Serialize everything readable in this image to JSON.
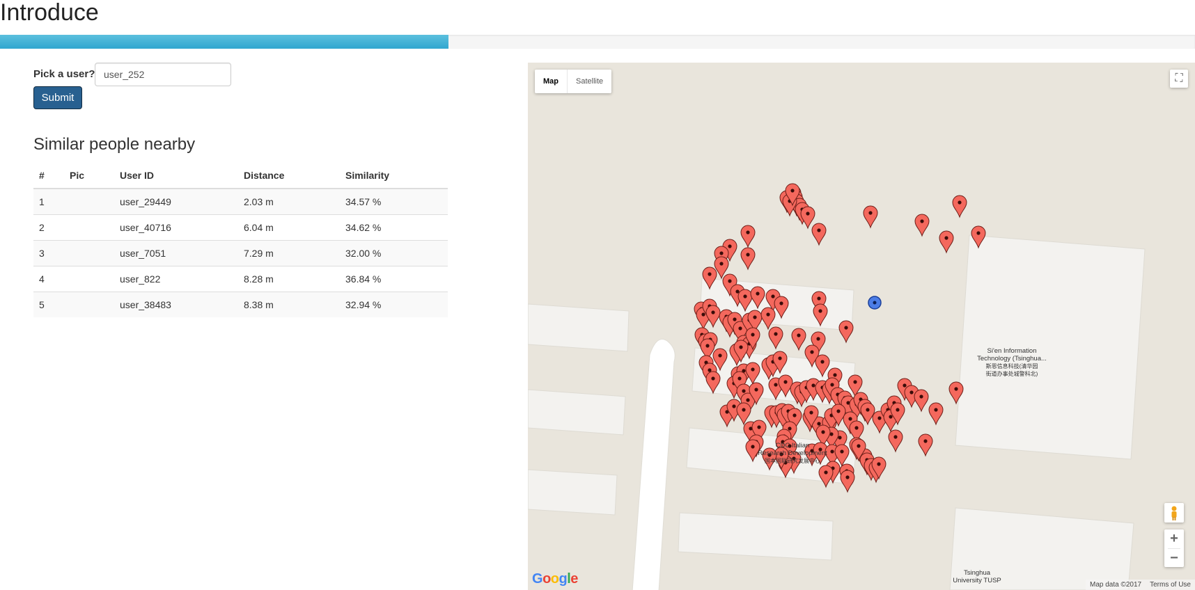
{
  "header": {
    "title": "Introduce",
    "progress": 0.375
  },
  "form": {
    "label": "Pick a user?",
    "input_value": "user_252",
    "submit_label": "Submit"
  },
  "results": {
    "title": "Similar people nearby",
    "columns": [
      "#",
      "Pic",
      "User ID",
      "Distance",
      "Similarity"
    ],
    "rows": [
      {
        "num": "1",
        "pic": "",
        "user_id": "user_29449",
        "distance": "2.03 m",
        "similarity": "34.57 %"
      },
      {
        "num": "2",
        "pic": "",
        "user_id": "user_40716",
        "distance": "6.04 m",
        "similarity": "34.62 %"
      },
      {
        "num": "3",
        "pic": "",
        "user_id": "user_7051",
        "distance": "7.29 m",
        "similarity": "32.00 %"
      },
      {
        "num": "4",
        "pic": "",
        "user_id": "user_822",
        "distance": "8.28 m",
        "similarity": "36.84 %"
      },
      {
        "num": "5",
        "pic": "",
        "user_id": "user_38483",
        "distance": "8.38 m",
        "similarity": "32.94 %"
      }
    ]
  },
  "map": {
    "type_buttons": [
      "Map",
      "Satellite"
    ],
    "active_type": "Map",
    "poi_labels": [
      {
        "lines": [
          "Si'en Information",
          "Technology (Tsinghua...",
          "斯恩信息科技(清华园",
          "街道办事处城警科北)"
        ]
      },
      {
        "lines": [
          "CDC Italian",
          "Research Development",
          "国本国联研究发展中心"
        ]
      },
      {
        "lines": [
          "Tsinghua",
          "University TUSP"
        ]
      }
    ],
    "attribution": [
      "Map data ©2017",
      "Terms of Use"
    ],
    "logo": "Google",
    "icons": [
      "fullscreen-icon",
      "pegman-icon",
      "zoom-in-icon",
      "zoom-out-icon"
    ],
    "colors": {
      "marker": "#f4685d",
      "current_user_marker": "#4c7de6"
    }
  }
}
